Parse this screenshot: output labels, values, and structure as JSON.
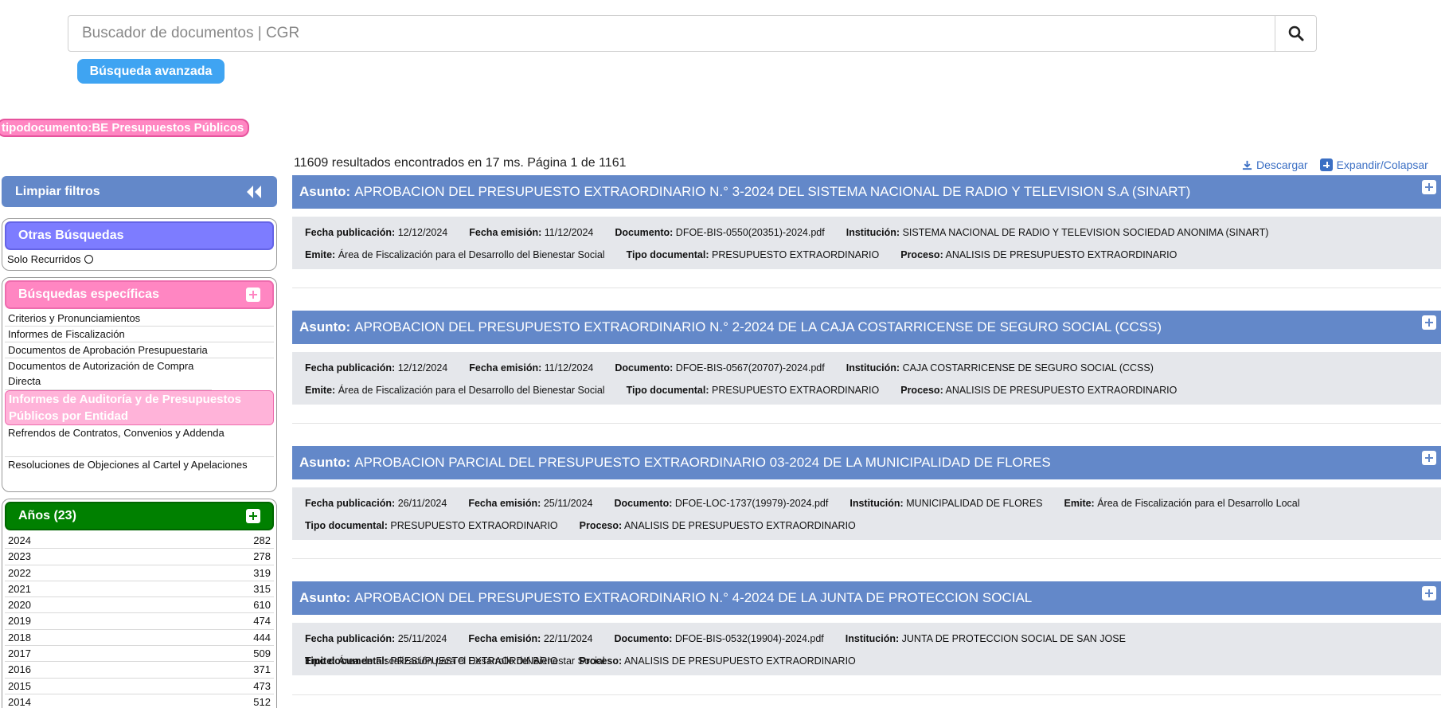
{
  "search": {
    "placeholder": "Buscador de documentos | CGR",
    "advanced_label": "Búsqueda avanzada"
  },
  "active_filter": "tipodocumento:BE Presupuestos Públicos",
  "results_summary": "11609 resultados encontrados en 17 ms. Página 1 de 1161",
  "actions": {
    "download": "Descargar",
    "expand": "Expandir/Colapsar"
  },
  "sidebar": {
    "clear_filters": "Limpiar filtros",
    "otras": {
      "title": "Otras Búsquedas",
      "solo_recurridos": "Solo Recurridos"
    },
    "especificas": {
      "title": "Búsquedas específicas",
      "items": [
        "Criterios y Pronunciamientos",
        "Informes de Fiscalización",
        "Documentos de Aprobación Presupuestaria",
        "Documentos de Autorización de Compra Directa",
        "Informes de Auditoría y de Presupuestos Públicos por Entidad",
        "Refrendos de Contratos, Convenios y Addenda",
        "Resoluciones de Objeciones al Cartel y Apelaciones"
      ],
      "active_index": 4
    },
    "anios": {
      "title": "Años (23)",
      "rows": [
        {
          "year": "2024",
          "count": "282"
        },
        {
          "year": "2023",
          "count": "278"
        },
        {
          "year": "2022",
          "count": "319"
        },
        {
          "year": "2021",
          "count": "315"
        },
        {
          "year": "2020",
          "count": "610"
        },
        {
          "year": "2019",
          "count": "474"
        },
        {
          "year": "2018",
          "count": "444"
        },
        {
          "year": "2017",
          "count": "509"
        },
        {
          "year": "2016",
          "count": "371"
        },
        {
          "year": "2015",
          "count": "473"
        },
        {
          "year": "2014",
          "count": "512"
        }
      ]
    }
  },
  "labels": {
    "asunto": "Asunto:",
    "fecha_publicacion": "Fecha publicación:",
    "fecha_emision": "Fecha emisión:",
    "documento": "Documento:",
    "institucion": "Institución:",
    "emite": "Emite:",
    "tipo_documental": "Tipo documental:",
    "proceso": "Proceso:"
  },
  "results": [
    {
      "asunto": "APROBACION DEL PRESUPUESTO EXTRAORDINARIO N.° 3-2024 DEL SISTEMA NACIONAL DE RADIO Y TELEVISION S.A (SINART)",
      "fecha_publicacion": "12/12/2024",
      "fecha_emision": "11/12/2024",
      "documento": "DFOE-BIS-0550(20351)-2024.pdf",
      "institucion": "SISTEMA NACIONAL DE RADIO Y TELEVISION SOCIEDAD ANONIMA (SINART)",
      "emite": "Área de Fiscalización para el Desarrollo del Bienestar Social",
      "tipo_documental": "PRESUPUESTO EXTRAORDINARIO",
      "proceso": "ANALISIS DE PRESUPUESTO EXTRAORDINARIO"
    },
    {
      "asunto": "APROBACION DEL PRESUPUESTO EXTRAORDINARIO N.° 2-2024 DE LA CAJA COSTARRICENSE DE SEGURO SOCIAL (CCSS)",
      "fecha_publicacion": "12/12/2024",
      "fecha_emision": "11/12/2024",
      "documento": "DFOE-BIS-0567(20707)-2024.pdf",
      "institucion": "CAJA COSTARRICENSE DE SEGURO SOCIAL (CCSS)",
      "emite": "Área de Fiscalización para el Desarrollo del Bienestar Social",
      "tipo_documental": "PRESUPUESTO EXTRAORDINARIO",
      "proceso": "ANALISIS DE PRESUPUESTO EXTRAORDINARIO"
    },
    {
      "asunto": "APROBACION PARCIAL DEL PRESUPUESTO EXTRAORDINARIO 03-2024 DE LA MUNICIPALIDAD DE FLORES",
      "fecha_publicacion": "26/11/2024",
      "fecha_emision": "25/11/2024",
      "documento": "DFOE-LOC-1737(19979)-2024.pdf",
      "institucion": "MUNICIPALIDAD DE FLORES",
      "emite": "Área de Fiscalización para el Desarrollo Local",
      "tipo_documental": "PRESUPUESTO EXTRAORDINARIO",
      "proceso": "ANALISIS DE PRESUPUESTO EXTRAORDINARIO"
    },
    {
      "asunto": "APROBACION DEL PRESUPUESTO EXTRAORDINARIO N.° 4-2024 DE LA JUNTA DE PROTECCION SOCIAL",
      "fecha_publicacion": "25/11/2024",
      "fecha_emision": "22/11/2024",
      "documento": "DFOE-BIS-0532(19904)-2024.pdf",
      "institucion": "JUNTA DE PROTECCION SOCIAL DE SAN JOSE",
      "emite": "Área de Fiscalización para el Desarrollo del Bienestar Social",
      "tipo_documental": "PRESUPUESTO EXTRAORDINARIO",
      "proceso": "ANALISIS DE PRESUPUESTO EXTRAORDINARIO"
    }
  ],
  "colors": {
    "primary_blue": "#6388c9",
    "advanced_blue": "#3fa4f2",
    "pink": "#ff86c2",
    "purple": "#7d7cff",
    "green": "#008000",
    "meta_bg": "#e5e7eb"
  }
}
